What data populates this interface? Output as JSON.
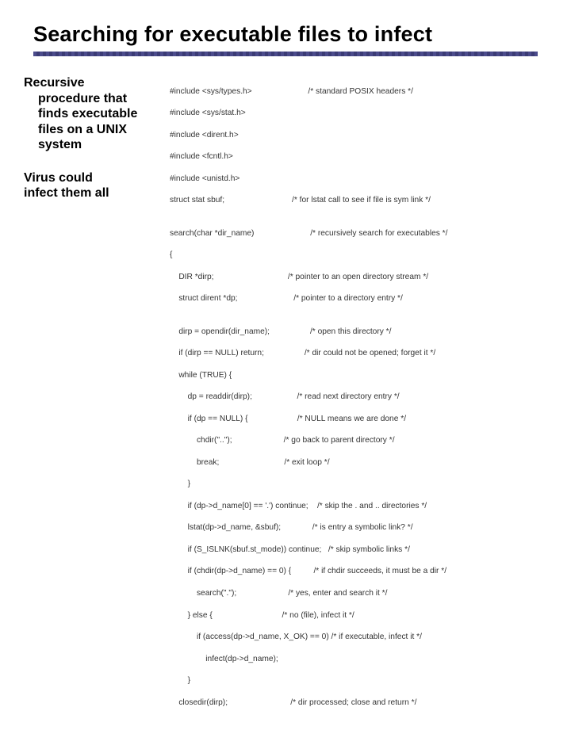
{
  "title": "Searching for executable files to infect",
  "left": {
    "p1": {
      "l1": "Recursive",
      "l2": "procedure that",
      "l3": "finds executable",
      "l4": "files on a UNIX",
      "l5": "system"
    },
    "p2": {
      "l1": "Virus could",
      "l2": "infect them all"
    }
  },
  "code": [
    "#include <sys/types.h>                         /* standard POSIX headers */",
    "#include <sys/stat.h>",
    "#include <dirent.h>",
    "#include <fcntl.h>",
    "#include <unistd.h>",
    "struct stat sbuf;                              /* for lstat call to see if file is sym link */",
    "",
    "search(char *dir_name)                         /* recursively search for executables */",
    "{",
    "    DIR *dirp;                                 /* pointer to an open directory stream */",
    "    struct dirent *dp;                         /* pointer to a directory entry */",
    "",
    "    dirp = opendir(dir_name);                  /* open this directory */",
    "    if (dirp == NULL) return;                  /* dir could not be opened; forget it */",
    "    while (TRUE) {",
    "        dp = readdir(dirp);                    /* read next directory entry */",
    "        if (dp == NULL) {                      /* NULL means we are done */",
    "            chdir(\"..\");                       /* go back to parent directory */",
    "            break;                             /* exit loop */",
    "        }",
    "        if (dp->d_name[0] == '.') continue;    /* skip the . and .. directories */",
    "        lstat(dp->d_name, &sbuf);              /* is entry a symbolic link? */",
    "        if (S_ISLNK(sbuf.st_mode)) continue;   /* skip symbolic links */",
    "        if (chdir(dp->d_name) == 0) {          /* if chdir succeeds, it must be a dir */",
    "            search(\".\");                       /* yes, enter and search it */",
    "        } else {                               /* no (file), infect it */",
    "            if (access(dp->d_name, X_OK) == 0) /* if executable, infect it */",
    "                infect(dp->d_name);",
    "        }",
    "    closedir(dirp);                            /* dir processed; close and return */",
    "}"
  ]
}
